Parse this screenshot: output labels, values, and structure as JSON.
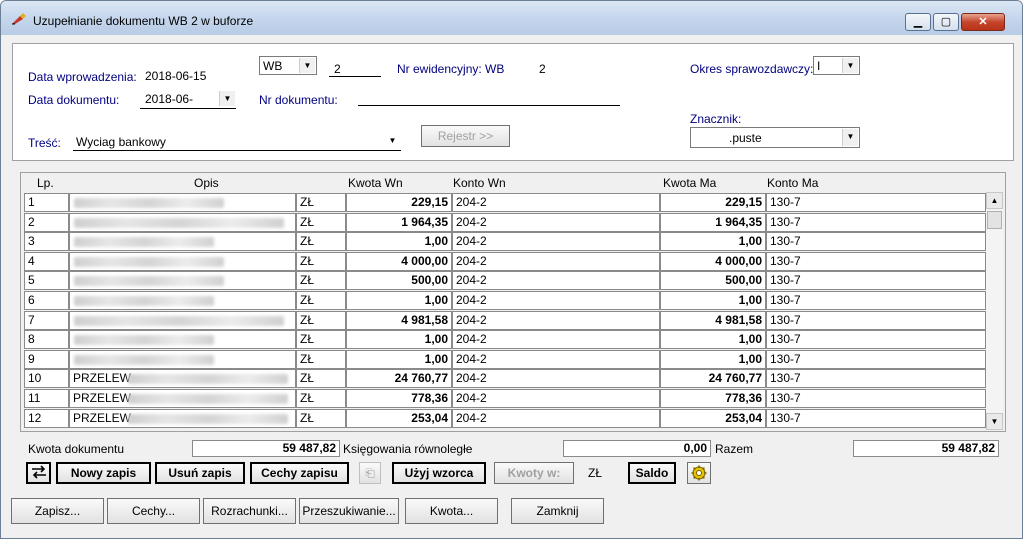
{
  "window": {
    "title": "Uzupełnianie dokumentu WB 2 w buforze"
  },
  "header": {
    "data_wprowadzenia_label": "Data wprowadzenia:",
    "data_wprowadzenia_value": "2018-06-15",
    "data_dokumentu_label": "Data dokumentu:",
    "data_dokumentu_value": "2018-06-",
    "doc_type_value": "WB",
    "doc_number_value": "2",
    "nr_ewidencyjny_label": "Nr ewidencyjny: WB",
    "nr_ewidencyjny_value": "2",
    "okres_label": "Okres sprawozdawczy:",
    "okres_value": "I",
    "nr_dokumentu_label": "Nr dokumentu:",
    "nr_dokumentu_value": "",
    "znacznik_label": "Znacznik:",
    "znacznik_value": ".puste",
    "tresc_label": "Treść:",
    "tresc_value": "Wyciag bankowy",
    "rejestr_button": "Rejestr >>"
  },
  "grid": {
    "columns": {
      "lp": "Lp.",
      "opis": "Opis",
      "kwota_wn": "Kwota  Wn",
      "konto_wn": "Konto  Wn",
      "kwota_ma": "Kwota Ma",
      "konto_ma": "Konto Ma"
    },
    "rows": [
      {
        "lp": "1",
        "opis": "",
        "cur": "ZŁ",
        "kwota_wn": "229,15",
        "konto_wn": "204-2",
        "kwota_ma": "229,15",
        "konto_ma": "130-7"
      },
      {
        "lp": "2",
        "opis": "",
        "cur": "ZŁ",
        "kwota_wn": "1 964,35",
        "konto_wn": "204-2",
        "kwota_ma": "1 964,35",
        "konto_ma": "130-7"
      },
      {
        "lp": "3",
        "opis": "",
        "cur": "ZŁ",
        "kwota_wn": "1,00",
        "konto_wn": "204-2",
        "kwota_ma": "1,00",
        "konto_ma": "130-7"
      },
      {
        "lp": "4",
        "opis": "",
        "cur": "ZŁ",
        "kwota_wn": "4 000,00",
        "konto_wn": "204-2",
        "kwota_ma": "4 000,00",
        "konto_ma": "130-7"
      },
      {
        "lp": "5",
        "opis": "",
        "cur": "ZŁ",
        "kwota_wn": "500,00",
        "konto_wn": "204-2",
        "kwota_ma": "500,00",
        "konto_ma": "130-7"
      },
      {
        "lp": "6",
        "opis": "",
        "cur": "ZŁ",
        "kwota_wn": "1,00",
        "konto_wn": "204-2",
        "kwota_ma": "1,00",
        "konto_ma": "130-7"
      },
      {
        "lp": "7",
        "opis": "",
        "cur": "ZŁ",
        "kwota_wn": "4 981,58",
        "konto_wn": "204-2",
        "kwota_ma": "4 981,58",
        "konto_ma": "130-7"
      },
      {
        "lp": "8",
        "opis": "",
        "cur": "ZŁ",
        "kwota_wn": "1,00",
        "konto_wn": "204-2",
        "kwota_ma": "1,00",
        "konto_ma": "130-7"
      },
      {
        "lp": "9",
        "opis": "",
        "cur": "ZŁ",
        "kwota_wn": "1,00",
        "konto_wn": "204-2",
        "kwota_ma": "1,00",
        "konto_ma": "130-7"
      },
      {
        "lp": "10",
        "opis": "PRZELEW",
        "cur": "ZŁ",
        "kwota_wn": "24 760,77",
        "konto_wn": "204-2",
        "kwota_ma": "24 760,77",
        "konto_ma": "130-7"
      },
      {
        "lp": "11",
        "opis": "PRZELEW",
        "cur": "ZŁ",
        "kwota_wn": "778,36",
        "konto_wn": "204-2",
        "kwota_ma": "778,36",
        "konto_ma": "130-7"
      },
      {
        "lp": "12",
        "opis": "PRZELEW",
        "cur": "ZŁ",
        "kwota_wn": "253,04",
        "konto_wn": "204-2",
        "kwota_ma": "253,04",
        "konto_ma": "130-7"
      }
    ]
  },
  "summary": {
    "kwota_dokumentu_label": "Kwota dokumentu",
    "kwota_dokumentu_value": "59 487,82",
    "ksiegowania_label": "Księgowania równoległe",
    "ksiegowania_value": "0,00",
    "razem_label": "Razem",
    "razem_value": "59 487,82"
  },
  "toolbar": {
    "nowy_zapis": "Nowy zapis",
    "usun_zapis": "Usuń zapis",
    "cechy_zapisu": "Cechy zapisu",
    "uzyj_wzorca": "Użyj wzorca",
    "kwoty_w": "Kwoty w:",
    "currency": "ZŁ",
    "saldo": "Saldo"
  },
  "footer": {
    "zapisz": "Zapisz...",
    "cechy": "Cechy...",
    "rozrachunki": "Rozrachunki...",
    "przeszukiwanie": "Przeszukiwanie...",
    "kwota": "Kwota...",
    "zamknij": "Zamknij"
  }
}
